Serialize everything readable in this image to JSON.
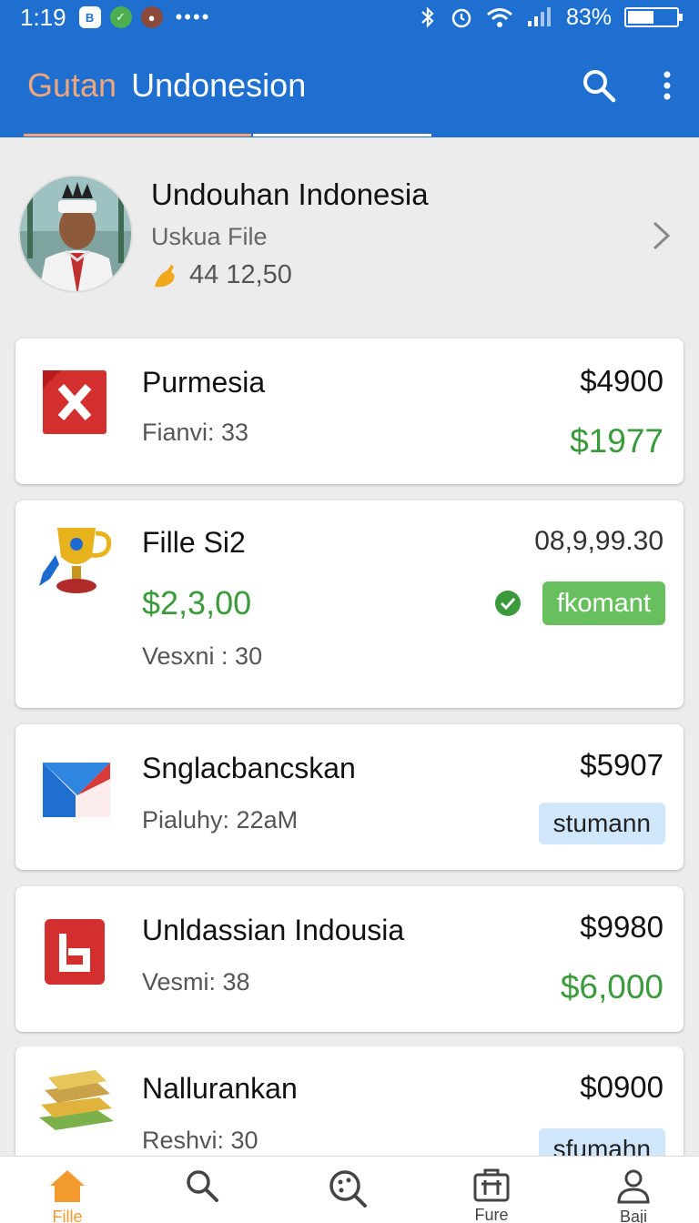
{
  "status_bar": {
    "time": "1:19",
    "battery": "83%",
    "icons": [
      "app-badge-icon",
      "check-circle-icon",
      "avatar-notif-icon",
      "more-dots-icon",
      "bluetooth-icon",
      "alarm-icon",
      "wifi-icon",
      "signal-icon",
      "battery-icon"
    ]
  },
  "app_bar": {
    "title_part1": "Gutan",
    "title_part2": "Undonesion",
    "actions": [
      "search-icon",
      "more-vert-icon"
    ]
  },
  "profile": {
    "name": "Undouhan Indonesia",
    "subtitle": "Uskua File",
    "score": "44 12,50"
  },
  "cards": [
    {
      "title": "Purmesia",
      "subtitle": "Fianvi: 33",
      "price": "$4900",
      "price2": "$1977",
      "icon": "red-x-icon"
    },
    {
      "title": "Fille Si2",
      "amount": "$2,3,00",
      "subtitle": "Vesxni : 30",
      "price": "08,9,99.30",
      "badge": "fkomant",
      "icon": "trophy-icon"
    },
    {
      "title": "Snglacbancskan",
      "subtitle": "Pialuhy: 22aM",
      "price": "$5907",
      "badge": "stumann",
      "icon": "mail-icon"
    },
    {
      "title": "Unldassian Indousia",
      "subtitle": "Vesmi: 38",
      "price": "$9980",
      "price2": "$6,000",
      "icon": "red-b-icon"
    },
    {
      "title": "Nallurankan",
      "subtitle": "Reshvi: 30",
      "price": "$0900",
      "badge": "sfumahn",
      "icon": "books-icon"
    }
  ],
  "bottom_nav": [
    {
      "label": "Fille",
      "icon": "home-icon",
      "active": true
    },
    {
      "label": "",
      "icon": "search-icon"
    },
    {
      "label": "",
      "icon": "explore-icon"
    },
    {
      "label": "Fure",
      "icon": "briefcase-icon"
    },
    {
      "label": "Baji",
      "icon": "profile-icon"
    }
  ],
  "colors": {
    "primary": "#1e6fd0",
    "accent": "#f0a67c",
    "green": "#3a9a3c",
    "badge_green": "#67bf5d",
    "badge_blue": "#cfe6fb",
    "nav_active": "#f29a2e"
  }
}
